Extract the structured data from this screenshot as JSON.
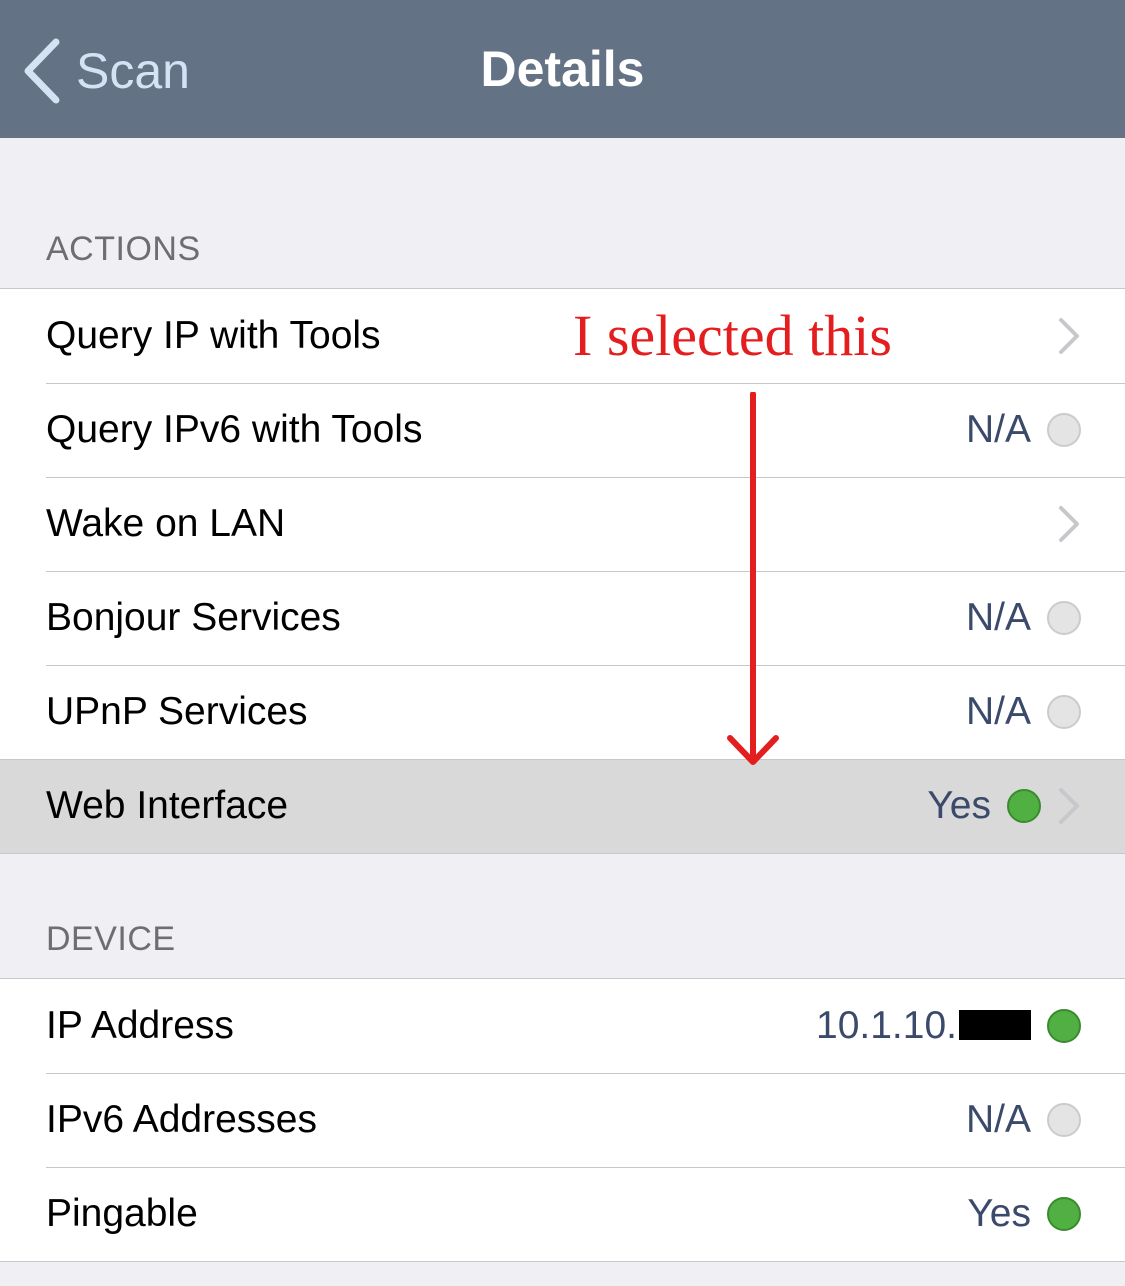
{
  "navbar": {
    "back_label": "Scan",
    "title": "Details",
    "background": "#637285"
  },
  "actions": {
    "header": "ACTIONS",
    "rows": [
      {
        "label": "Query IP with Tools",
        "value": "",
        "indicator": "none",
        "chevron": true
      },
      {
        "label": "Query IPv6 with Tools",
        "value": "N/A",
        "indicator": "gray-dot",
        "chevron": false
      },
      {
        "label": "Wake on LAN",
        "value": "",
        "indicator": "none",
        "chevron": true
      },
      {
        "label": "Bonjour Services",
        "value": "N/A",
        "indicator": "gray-dot",
        "chevron": false
      },
      {
        "label": "UPnP Services",
        "value": "N/A",
        "indicator": "gray-dot",
        "chevron": false
      },
      {
        "label": "Web Interface",
        "value": "Yes",
        "indicator": "green-dot",
        "chevron": true,
        "highlighted": true
      }
    ]
  },
  "device": {
    "header": "DEVICE",
    "rows": [
      {
        "label": "IP Address",
        "value": "10.1.10.",
        "value_redacted": true,
        "indicator": "green-dot"
      },
      {
        "label": "IPv6 Addresses",
        "value": "N/A",
        "indicator": "gray-dot"
      },
      {
        "label": "Pingable",
        "value": "Yes",
        "indicator": "green-dot"
      }
    ]
  },
  "annotation": {
    "text": "I selected this",
    "color": "#e41e1e"
  },
  "icons": {
    "back": "chevron-left-icon",
    "disclosure": "chevron-right-icon",
    "status_unavailable": "gray-dot-icon",
    "status_available": "green-dot-icon"
  }
}
